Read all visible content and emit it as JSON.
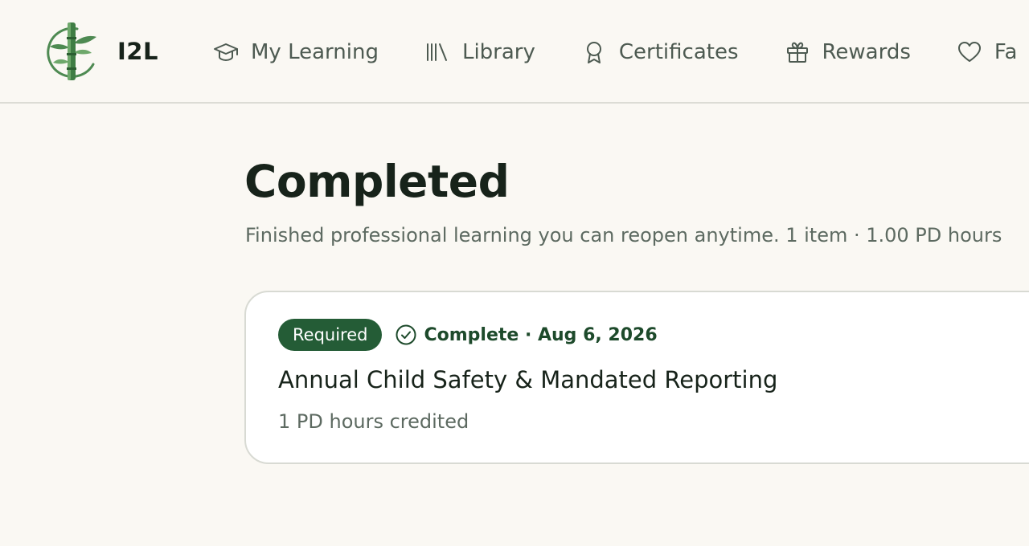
{
  "brand": {
    "name": "I2L",
    "logo_icon": "bamboo-logo-icon"
  },
  "nav": {
    "items": [
      {
        "label": "My Learning",
        "icon": "graduation-cap-icon"
      },
      {
        "label": "Library",
        "icon": "library-books-icon"
      },
      {
        "label": "Certificates",
        "icon": "award-ribbon-icon"
      },
      {
        "label": "Rewards",
        "icon": "gift-icon"
      },
      {
        "label": "Fa",
        "icon": "heart-icon"
      }
    ]
  },
  "page": {
    "title": "Completed",
    "subtitle": "Finished professional learning you can reopen anytime. 1 item · 1.00 PD hours"
  },
  "course": {
    "tag": "Required",
    "status_icon": "check-circle-icon",
    "status": "Complete · Aug 6, 2026",
    "title": "Annual Child Safety & Mandated Reporting",
    "hours": "1 PD hours credited"
  },
  "colors": {
    "background": "#faf8f3",
    "accent": "#245c36",
    "text_primary": "#17231a",
    "text_muted": "#5d6a61",
    "nav_text": "#4d5a51"
  }
}
